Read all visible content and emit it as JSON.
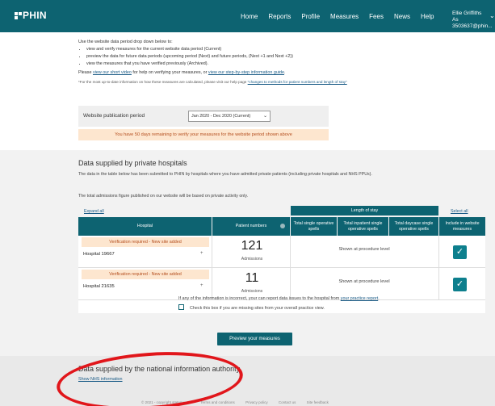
{
  "header": {
    "logo": "PHIN",
    "nav": [
      "Home",
      "Reports",
      "Profile",
      "Measures",
      "Fees",
      "News",
      "Help"
    ],
    "user_name": "Ellie Griffiths",
    "user_sub": "As 3503637@phin..."
  },
  "intro": {
    "lead": "Use the website data period drop down below to:",
    "bullets": [
      "view and verify measures for the current website data period (Current)",
      "preview the data for future data periods (upcoming period (Next) and future periods, (Next +1 and Next +2))",
      "view the measures that you have verified previously (Archived)."
    ],
    "help_pre": "Please ",
    "help_link1": "view our short video",
    "help_mid": " for help on verifying your measures, or ",
    "help_link2": "view our step-by-step information guide",
    "help_post": ".",
    "note_pre": "*For the most up-to-date information on how these measures are calculated, please visit our help page ",
    "note_link": "\"changes to methods for patient numbers and length of stay\""
  },
  "period": {
    "label": "Website publication period",
    "selected": "Jan 2020 - Dec 2020 (Current)"
  },
  "notice": "You have 50 days remaining to verify your measures for the website period shown above",
  "private": {
    "title": "Data supplied by private hospitals",
    "desc": "The data in the table below has been submitted to PHIN by hospitals where you have admitted private patients (including private hospitals and NHS PPUs).",
    "total": "The total admissions figure published on our website will be based on private activity only.",
    "expand_all": "Expand all",
    "select_all": "Select all",
    "headers": {
      "length_of_stay": "Length of stay",
      "hospital": "Hospital",
      "patient_numbers": "Patient numbers",
      "total_single": "Total single operative spells",
      "total_inpatient": "Total inpatient single operative spells",
      "total_daycase": "Total daycase single operative spells",
      "include": "Include in website measures"
    },
    "rows": [
      {
        "warning": "Verification required - New site added",
        "hospital": "Hospital 19667",
        "patients": "121",
        "patients_sub": "Admissions",
        "length": "Shown at procedure level"
      },
      {
        "warning": "Verification required - New site added",
        "hospital": "Hospital 21635",
        "patients": "11",
        "patients_sub": "Admissions",
        "length": "Shown at procedure level"
      }
    ],
    "footnote_pre": "If any of the information is incorrect, your can report data issues to the hospital from ",
    "footnote_link": "your practice report",
    "footnote_post": ".",
    "missing": "Check this box if you are missing sites from your overall practice view."
  },
  "preview_button": "Preview your measures",
  "national": {
    "title": "Data supplied by the national information authority",
    "link": "Show NHS information"
  },
  "footer": [
    "© 2021 - copyright statements",
    "Terms and conditions",
    "Privacy policy",
    "Contact us",
    "Site feedback"
  ],
  "colors": {
    "brand": "#0d6371",
    "annotation": "#e1161b",
    "warning_bg": "#fde6cf"
  }
}
